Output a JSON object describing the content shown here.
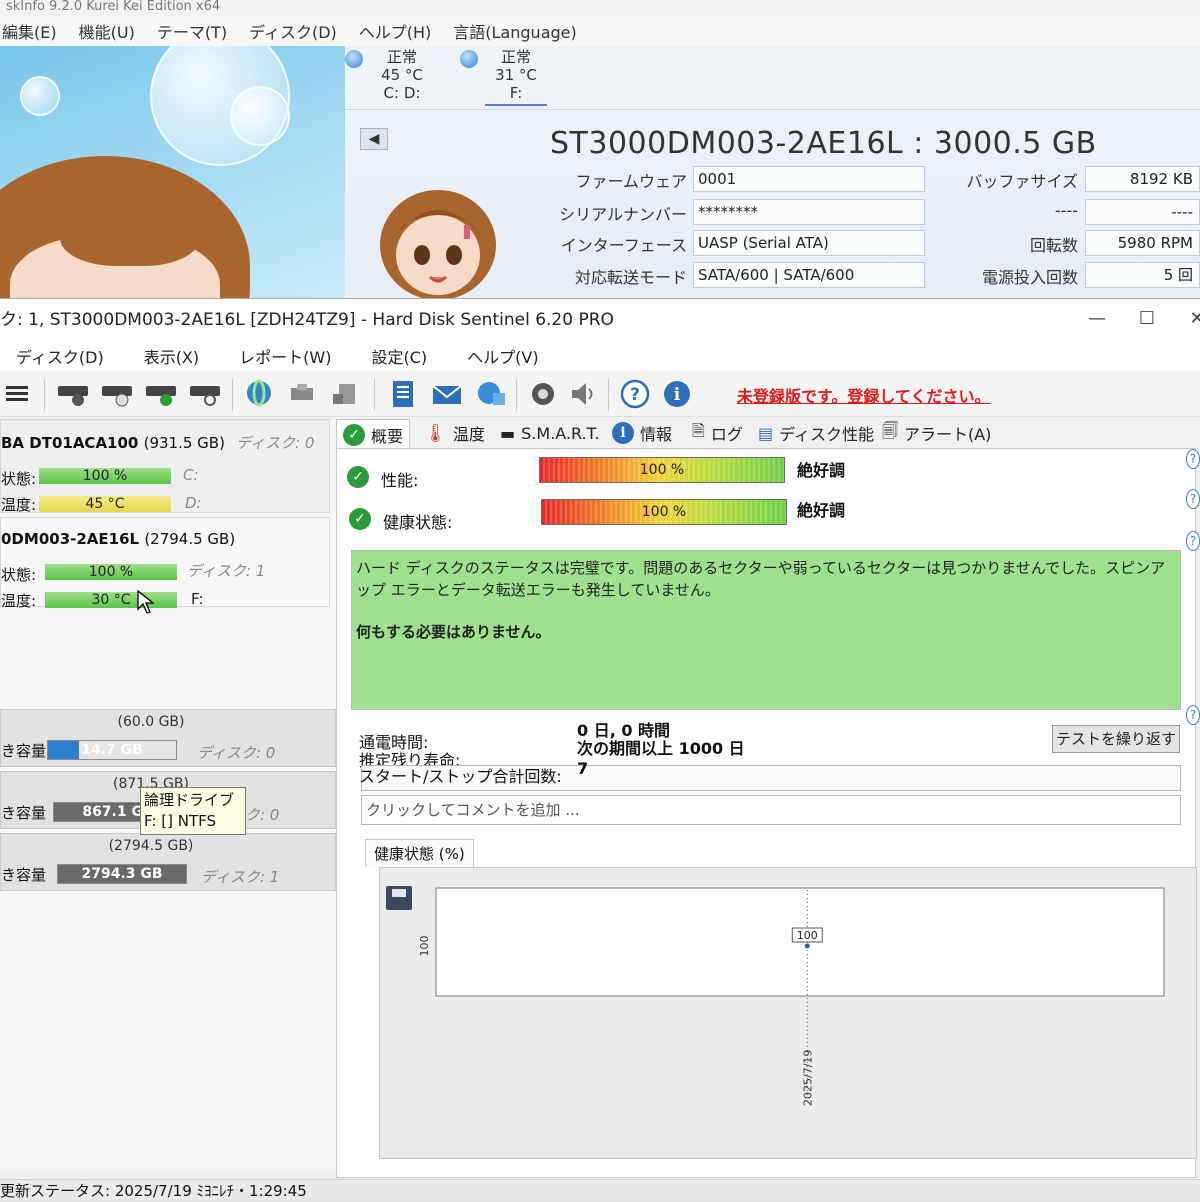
{
  "cdi": {
    "titlebar": "skInfo 9.2.0 Kurei Kei Edition x64",
    "menu": [
      "編集(E)",
      "機能(U)",
      "テーマ(T)",
      "ディスク(D)",
      "ヘルプ(H)",
      "言語(Language)"
    ],
    "drives": [
      {
        "status": "正常",
        "temp": "45 °C",
        "letters": "C: D:"
      },
      {
        "status": "正常",
        "temp": "31 °C",
        "letters": "F:"
      }
    ],
    "model": "ST3000DM003-2AE16L : 3000.5 GB",
    "back_label": "◀",
    "firmware_label": "ファームウェア",
    "firmware": "0001",
    "serial_label": "シリアルナンバー",
    "serial": "********",
    "interface_label": "インターフェース",
    "interface": "UASP (Serial ATA)",
    "transfer_label": "対応転送モード",
    "transfer": "SATA/600 | SATA/600",
    "buffer_label": "バッファサイズ",
    "buffer": "8192 KB",
    "blank_label": "----",
    "blank": "----",
    "rpm_label": "回転数",
    "rpm": "5980 RPM",
    "power_label": "電源投入回数",
    "power": "5 回"
  },
  "hds": {
    "title": "ク: 1, ST3000DM003-2AE16L [ZDH24TZ9]  -  Hard Disk Sentinel 6.20 PRO",
    "window_buttons": [
      "—",
      "☐",
      "✕"
    ],
    "menu": [
      "ディスク(D)",
      "表示(X)",
      "レポート(W)",
      "設定(C)",
      "ヘルプ(V)"
    ],
    "register_notice": "未登録版です。登録してください。",
    "disks": [
      {
        "name": "BA DT01ACA100",
        "size": "(931.5 GB)",
        "disk": "ディスク: 0",
        "health_label": "状態:",
        "health": "100 %",
        "health_drive": "C:",
        "temp_label": "温度:",
        "temp": "45 °C",
        "temp_drive": "D:"
      },
      {
        "name": "0DM003-2AE16L",
        "size": "(2794.5 GB)",
        "disk": "",
        "health_label": "状態:",
        "health": "100 %",
        "health_drive": "ディスク: 1",
        "temp_label": "温度:",
        "temp": "30 °C",
        "temp_drive": "F:"
      }
    ],
    "tooltip": {
      "line1": "論理ドライブ",
      "line2": "F: [] NTFS"
    },
    "volumes": [
      {
        "size": "(60.0 GB)",
        "label": "き容量",
        "free": "14.7 GB",
        "disk": "ディスク: 0",
        "color": "#2f7fd0"
      },
      {
        "size": "(871.5 GB)",
        "label": "き容量",
        "free": "867.1 GB",
        "disk": "ディスク: 0",
        "color": "#6a6a6a"
      },
      {
        "size": "(2794.5 GB)",
        "label": "き容量",
        "free": "2794.3 GB",
        "disk": "ディスク: 1",
        "color": "#6a6a6a"
      }
    ],
    "tabs": [
      "概要",
      "温度",
      "S.M.A.R.T.",
      "情報",
      "ログ",
      "ディスク性能",
      "アラート(A)"
    ],
    "performance_label": "性能:",
    "performance": "100 %",
    "performance_grade": "絶好調",
    "health_label": "健康状態:",
    "health": "100 %",
    "health_grade": "絶好調",
    "status_text": "ハード ディスクのステータスは完璧です。問題のあるセクターや弱っているセクターは見つかりませんでした。スピンアップ エラーとデータ転送エラーも発生していません。",
    "status_action": "何もする必要はありません。",
    "power_on_label": "通電時間:",
    "power_on": "0 日, 0 時間",
    "remaining_label": "推定残り寿命:",
    "remaining": "次の期間以上 1000 日",
    "startstop_label": "スタート/ストップ合計回数:",
    "startstop": "7",
    "retest_button": "テストを繰り返す",
    "comment_placeholder": "クリックしてコメントを追加 ...",
    "chart_tab": "健康状態 (%)",
    "statusbar": "更新ステータス: 2025/7/19 ﾐﾖﾆﾚﾁ・1:29:45"
  },
  "chart_data": {
    "type": "line",
    "title": "健康状態 (%)",
    "x": [
      "2025/7/19"
    ],
    "series": [
      {
        "values": [
          100
        ]
      }
    ],
    "ytick_labels": [
      "100"
    ],
    "data_labels": [
      "100"
    ],
    "grid": false
  },
  "colors": {
    "accent_red": "#e01a1a",
    "status_green": "#9ee18f",
    "check_green": "#2a9d3a",
    "bar_green": "#5bc44a",
    "bar_yellow": "#e5d84b"
  }
}
